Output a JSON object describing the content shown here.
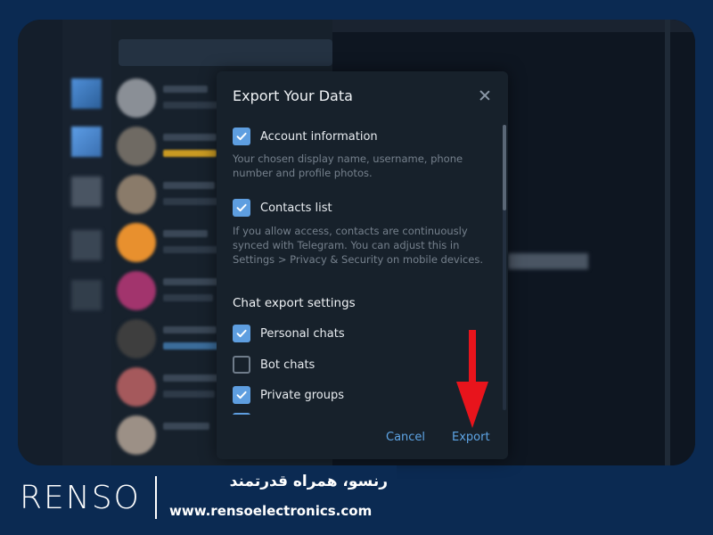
{
  "dialog": {
    "title": "Export Your Data",
    "options": [
      {
        "label": "Account information",
        "checked": true
      },
      {
        "label": "Contacts list",
        "checked": true
      }
    ],
    "descriptions": [
      "Your chosen display name, username, phone number and profile photos.",
      "If you allow access, contacts are continuously synced with Telegram. You can adjust this in Settings > Privacy & Security on mobile devices."
    ],
    "section_title": "Chat export settings",
    "chat_options": [
      {
        "label": "Personal chats",
        "checked": true
      },
      {
        "label": "Bot chats",
        "checked": false
      },
      {
        "label": "Private groups",
        "checked": true
      }
    ],
    "cancel_label": "Cancel",
    "export_label": "Export"
  },
  "brand": {
    "logo": "RENSO",
    "tagline": "رنسو، همراه قدرتمند",
    "url": "www.rensoelectronics.com"
  },
  "colors": {
    "accent": "#5e9ee0",
    "button_text": "#5ea5e6",
    "annotation_arrow": "#e8141c",
    "brand_bg": "#0b2a52"
  },
  "icons": [
    "close-icon",
    "check-icon",
    "red-arrow-down-icon"
  ]
}
